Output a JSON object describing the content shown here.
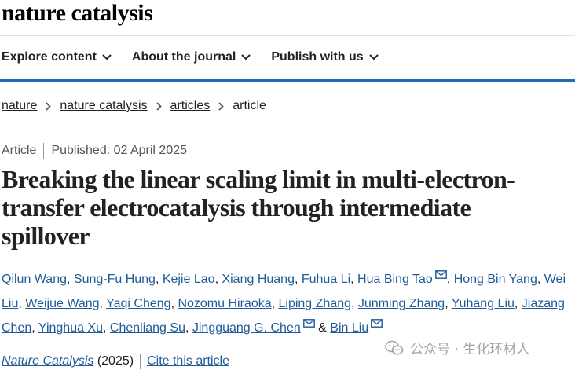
{
  "header": {
    "logo": "nature catalysis"
  },
  "nav": {
    "items": [
      {
        "label": "Explore content"
      },
      {
        "label": "About the journal"
      },
      {
        "label": "Publish with us"
      }
    ]
  },
  "breadcrumb": {
    "items": [
      {
        "label": "nature"
      },
      {
        "label": "nature catalysis"
      },
      {
        "label": "articles"
      }
    ],
    "current": "article"
  },
  "meta": {
    "type": "Article",
    "published": "Published: 02 April 2025"
  },
  "article": {
    "title": "Breaking the linear scaling limit in multi-electron-transfer electrocatalysis through intermediate spillover"
  },
  "authors": [
    {
      "name": "Qilun Wang",
      "mail": false
    },
    {
      "name": "Sung-Fu Hung",
      "mail": false
    },
    {
      "name": "Kejie Lao",
      "mail": false
    },
    {
      "name": "Xiang Huang",
      "mail": false
    },
    {
      "name": "Fuhua Li",
      "mail": false
    },
    {
      "name": "Hua Bing Tao",
      "mail": true
    },
    {
      "name": "Hong Bin Yang",
      "mail": false
    },
    {
      "name": "Wei Liu",
      "mail": false
    },
    {
      "name": "Weijue Wang",
      "mail": false
    },
    {
      "name": "Yaqi Cheng",
      "mail": false
    },
    {
      "name": "Nozomu Hiraoka",
      "mail": false
    },
    {
      "name": "Liping Zhang",
      "mail": false
    },
    {
      "name": "Junming Zhang",
      "mail": false
    },
    {
      "name": "Yuhang Liu",
      "mail": false
    },
    {
      "name": "Jiazang Chen",
      "mail": false
    },
    {
      "name": "Yinghua Xu",
      "mail": false
    },
    {
      "name": "Chenliang Su",
      "mail": false
    },
    {
      "name": "Jingguang G. Chen",
      "mail": true
    },
    {
      "name": "Bin Liu",
      "mail": true
    }
  ],
  "author_separator": ", ",
  "author_last_joiner": " & ",
  "citation": {
    "journal": "Nature Catalysis",
    "year": " (2025)",
    "cite_label": "Cite this article"
  },
  "watermark": {
    "text": "公众号 · 生化环材人"
  },
  "icons": {
    "nav": "chevron-down-icon",
    "breadcrumb": "chevron-right-icon",
    "author": "mail-icon",
    "watermark": "wechat-icon"
  },
  "colors": {
    "accent": "#1f6eb3",
    "link": "#1f5b99"
  }
}
